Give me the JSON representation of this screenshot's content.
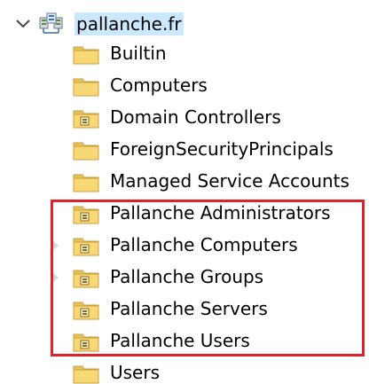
{
  "tree": {
    "root": {
      "label": "pallanche.fr",
      "expanded": true,
      "icon": "domain-icon"
    },
    "items": [
      {
        "label": "Builtin",
        "icon": "folder-icon",
        "has_children": false
      },
      {
        "label": "Computers",
        "icon": "folder-icon",
        "has_children": false
      },
      {
        "label": "Domain Controllers",
        "icon": "ou-folder-icon",
        "has_children": false
      },
      {
        "label": "ForeignSecurityPrincipals",
        "icon": "folder-icon",
        "has_children": false
      },
      {
        "label": "Managed Service Accounts",
        "icon": "folder-icon",
        "has_children": false
      },
      {
        "label": "Pallanche Administrators",
        "icon": "ou-folder-icon",
        "has_children": false
      },
      {
        "label": "Pallanche Computers",
        "icon": "ou-folder-icon",
        "has_children": true
      },
      {
        "label": "Pallanche Groups",
        "icon": "ou-folder-icon",
        "has_children": true
      },
      {
        "label": "Pallanche Servers",
        "icon": "ou-folder-icon",
        "has_children": false
      },
      {
        "label": "Pallanche Users",
        "icon": "ou-folder-icon",
        "has_children": false
      },
      {
        "label": "Users",
        "icon": "folder-icon",
        "has_children": false
      }
    ]
  },
  "colors": {
    "selection": "#cce8ff",
    "highlight_border": "#e0202a",
    "folder_fill": "#f8d775",
    "folder_dark": "#e0b44a"
  }
}
